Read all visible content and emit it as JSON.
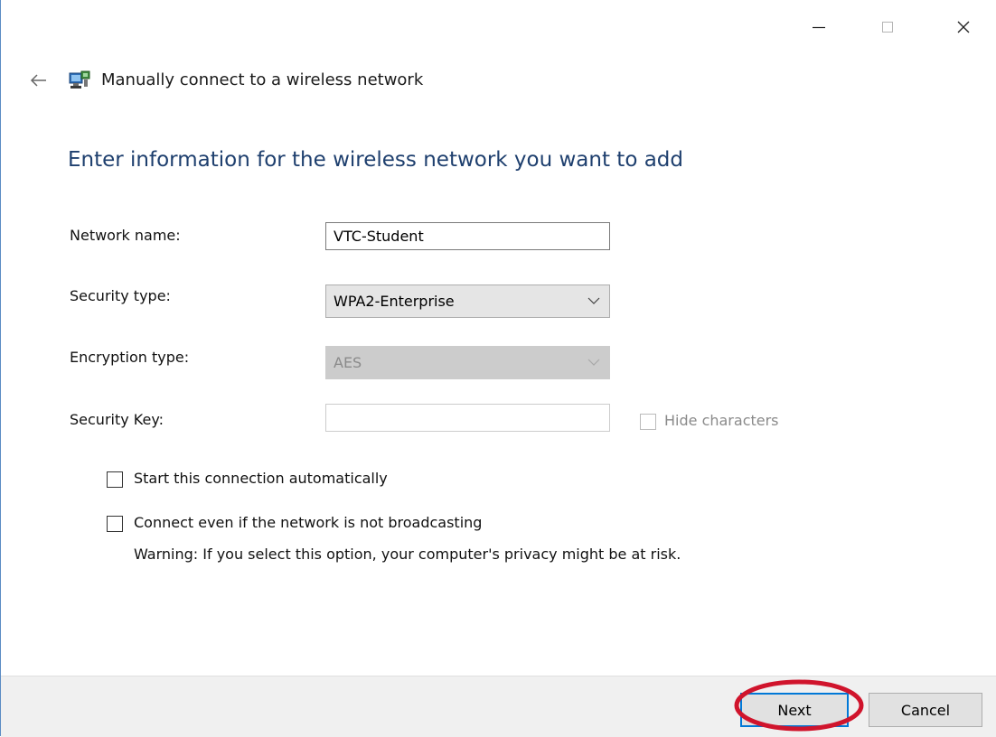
{
  "window": {
    "controls": {
      "minimize_icon": "minimize-icon",
      "maximize_icon": "maximize-icon",
      "close_icon": "close-icon"
    }
  },
  "wizard": {
    "title": "Manually connect to a wireless network",
    "heading": "Enter information for the wireless network you want to add"
  },
  "form": {
    "network_name": {
      "label": "Network name:",
      "value": "VTC-Student"
    },
    "security_type": {
      "label": "Security type:",
      "value": "WPA2-Enterprise"
    },
    "encryption_type": {
      "label": "Encryption type:",
      "value": "AES"
    },
    "security_key": {
      "label": "Security Key:",
      "value": "",
      "hide_label": "Hide characters"
    },
    "start_auto": {
      "label": "Start this connection automatically",
      "checked": false
    },
    "connect_even": {
      "label": "Connect even if the network is not broadcasting",
      "checked": false
    },
    "warning": "Warning: If you select this option, your computer's privacy might be at risk."
  },
  "buttons": {
    "next": "Next",
    "cancel": "Cancel"
  },
  "colors": {
    "heading": "#1e3f6e",
    "highlight": "#d0142c",
    "focus": "#0078d7"
  }
}
